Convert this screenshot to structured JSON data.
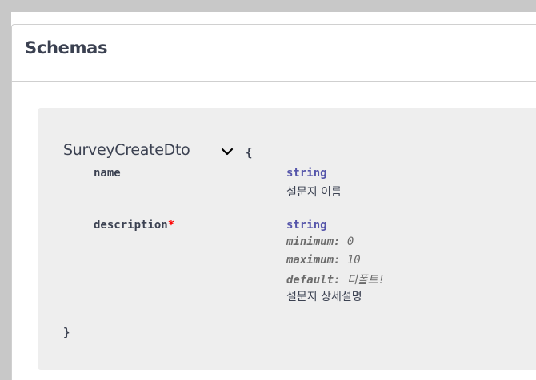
{
  "section": {
    "title": "Schemas"
  },
  "model": {
    "name": "SurveyCreateDto",
    "open_brace": "{",
    "close_brace": "}",
    "properties": [
      {
        "name": "name",
        "required": false,
        "type": "string",
        "description": "설문지 이름"
      },
      {
        "name": "description",
        "required": true,
        "required_marker": "*",
        "type": "string",
        "meta": [
          {
            "key": "minimum:",
            "value": "0"
          },
          {
            "key": "maximum:",
            "value": "10"
          },
          {
            "key": "default:",
            "value": "디폴트!"
          }
        ],
        "description": "설문지 상세설명"
      }
    ]
  },
  "icons": {
    "toggle": "chevron-down-icon"
  },
  "colors": {
    "type": "#5555aa",
    "required": "#ff0000",
    "text": "#3b4151",
    "model_bg": "#eeeeee"
  }
}
